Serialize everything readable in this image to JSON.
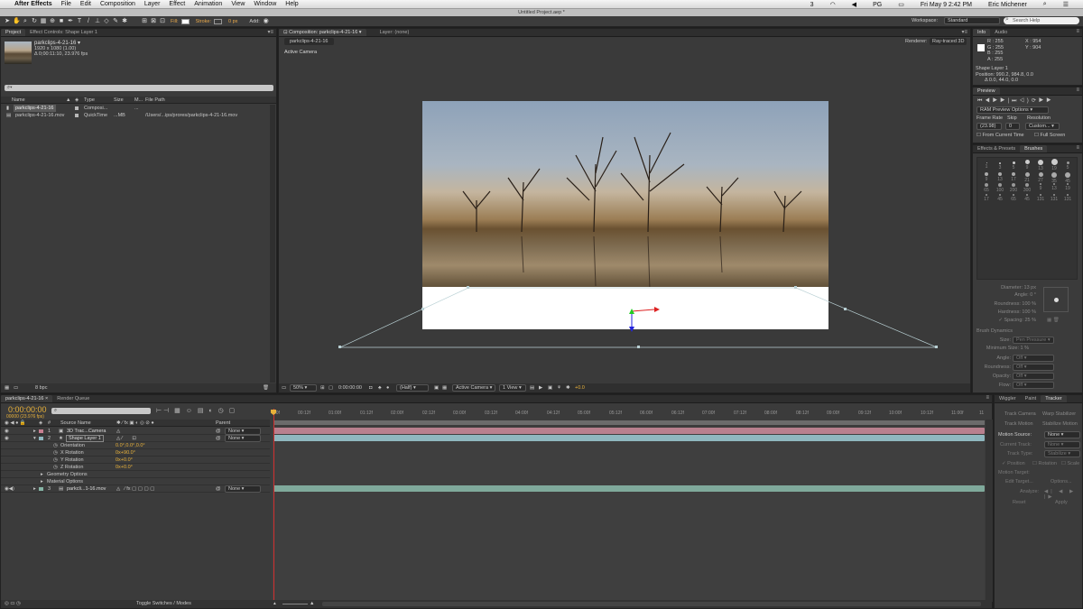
{
  "menubar": {
    "apple": "",
    "app": "After Effects",
    "items": [
      "File",
      "Edit",
      "Composition",
      "Layer",
      "Effect",
      "Animation",
      "View",
      "Window",
      "Help"
    ],
    "status": [
      "3",
      "PG"
    ],
    "datetime": "Fri May 9  2:42 PM",
    "user": "Eric Michener"
  },
  "window_title": "Untitled Project.aep *",
  "toolbar": {
    "fill_label": "Fill:",
    "stroke_label": "Stroke:",
    "stroke_px": "0 px",
    "add_label": "Add:",
    "workspace_label": "Workspace:",
    "workspace_value": "Standard",
    "search_placeholder": "Search Help"
  },
  "project_panel": {
    "tabs": [
      "Project",
      "Effect Controls: Shape Layer 1"
    ],
    "footage_name": "parkclips-4-21-16 ▾",
    "footage_dims": "1920 x 1080 (1.00)",
    "footage_duration": "Δ 0;00:11:10, 23.976 fps",
    "search_placeholder": "⌕▾",
    "columns": [
      "Name",
      "Type",
      "Size",
      "M...",
      "File Path"
    ],
    "items": [
      {
        "name": "parkclips-4-21-16",
        "type": "Composi...",
        "size": "",
        "media": "...",
        "path": ""
      },
      {
        "name": "parkclips-4-21-16.mov",
        "type": "QuickTime",
        "size": "...MB",
        "media": "",
        "path": "/Users/...ips/prores/parkclips-4-21-16.mov"
      }
    ],
    "bpc": "8 bpc"
  },
  "comp_panel": {
    "tabs": [
      "Composition: parkclips-4-21-16",
      "Layer: (none)"
    ],
    "breadcrumb": "parkclips-4-21-16",
    "renderer_label": "Renderer:",
    "renderer_value": "Ray-traced 3D",
    "view_label": "Active Camera",
    "footer": {
      "zoom": "50%",
      "timecode": "0:00:00:00",
      "resolution": "(Half)",
      "camera": "Active Camera",
      "views": "1 View",
      "exposure": "+0.0"
    }
  },
  "info_panel": {
    "tabs": [
      "Info",
      "Audio"
    ],
    "rgba": [
      "R : 255",
      "G : 255",
      "B : 255",
      "A : 255"
    ],
    "xy": [
      "X : 954",
      "Y : 904"
    ],
    "layer_name": "Shape Layer 1",
    "position": "Position: 990.2, 984.8, 0.0",
    "delta": "Δ 0.0, 44.0, 0.0"
  },
  "preview_panel": {
    "tab": "Preview",
    "ram_options": "RAM Preview Options",
    "frame_rate_label": "Frame Rate",
    "skip_label": "Skip",
    "resolution_label": "Resolution",
    "frame_rate": "(23.98)",
    "skip": "0",
    "resolution": "Custom...",
    "from_current": "From Current Time",
    "full_screen": "Full Screen"
  },
  "brushes_panel": {
    "tabs": [
      "Effects & Presets",
      "Brushes"
    ],
    "sizes": [
      "1",
      "3",
      "5",
      "9",
      "13",
      "19",
      "5",
      "9",
      "13",
      "17",
      "21",
      "27",
      "35",
      "45",
      "65",
      "100",
      "200",
      "300",
      "9",
      "13",
      "19",
      "17",
      "45",
      "65",
      "45",
      "131",
      "131",
      "131"
    ],
    "props": [
      {
        "label": "Diameter:",
        "value": "13 px"
      },
      {
        "label": "Angle:",
        "value": "0 °"
      },
      {
        "label": "Roundness:",
        "value": "100 %"
      },
      {
        "label": "Hardness:",
        "value": "100 %"
      },
      {
        "label": "Spacing:",
        "value": "25 %"
      }
    ],
    "dynamics_title": "Brush Dynamics",
    "dynamics": [
      {
        "label": "Size:",
        "value": "Pen Pressure"
      },
      {
        "label": "Minimum Size:",
        "value": "1 %"
      },
      {
        "label": "Angle:",
        "value": "Off"
      },
      {
        "label": "Roundness:",
        "value": "Off"
      },
      {
        "label": "Opacity:",
        "value": "Off"
      },
      {
        "label": "Flow:",
        "value": "Off"
      }
    ]
  },
  "tracker_panel": {
    "tabs": [
      "Wiggler",
      "Paint",
      "Tracker"
    ],
    "buttons": [
      "Track Camera",
      "Warp Stabilizer",
      "Track Motion",
      "Stabilize Motion"
    ],
    "motion_source_label": "Motion Source:",
    "motion_source": "None",
    "current_track_label": "Current Track:",
    "current_track": "None",
    "track_type_label": "Track Type:",
    "track_type": "Stabilize",
    "checks": [
      "Position",
      "Rotation",
      "Scale"
    ],
    "motion_target": "Motion Target:",
    "edit_target": "Edit Target...",
    "options": "Options...",
    "analyze": "Analyze:",
    "reset": "Reset",
    "apply": "Apply"
  },
  "timeline": {
    "tabs": [
      "parkclips-4-21-16",
      "Render Queue"
    ],
    "timecode": "0:00:00:00",
    "frames": "00000 (23.976 fps)",
    "col_source": "Source Name",
    "col_parent": "Parent",
    "ruler": [
      "00f",
      "00:12f",
      "01:00f",
      "01:12f",
      "02:00f",
      "02:12f",
      "03:00f",
      "03:12f",
      "04:00f",
      "04:12f",
      "05:00f",
      "05:12f",
      "06:00f",
      "06:12f",
      "07:00f",
      "07:12f",
      "08:00f",
      "08:12f",
      "09:00f",
      "09:12f",
      "10:00f",
      "10:12f",
      "11:00f",
      "11"
    ],
    "layers": [
      {
        "num": "1",
        "name": "3D Trac...Camera",
        "parent": "None"
      },
      {
        "num": "2",
        "name": "Shape Layer 1",
        "parent": "None"
      },
      {
        "num": "3",
        "name": "parkcli...1-16.mov",
        "parent": "None"
      }
    ],
    "props": [
      {
        "name": "Orientation",
        "value": "0.0°,0.0°,0.0°"
      },
      {
        "name": "X Rotation",
        "value": "0x+90.0°"
      },
      {
        "name": "Y Rotation",
        "value": "0x+0.0°"
      },
      {
        "name": "Z Rotation",
        "value": "0x+0.0°"
      },
      {
        "name": "Geometry Options",
        "value": ""
      },
      {
        "name": "Material Options",
        "value": ""
      }
    ],
    "toggle_label": "Toggle Switches / Modes"
  },
  "colors": {
    "accent_timecode": "#e8b13a",
    "camera_label": "#c77f91",
    "shape_label": "#8fb7bf",
    "footage_label": "#86b5a6",
    "playhead": "#d33030"
  }
}
